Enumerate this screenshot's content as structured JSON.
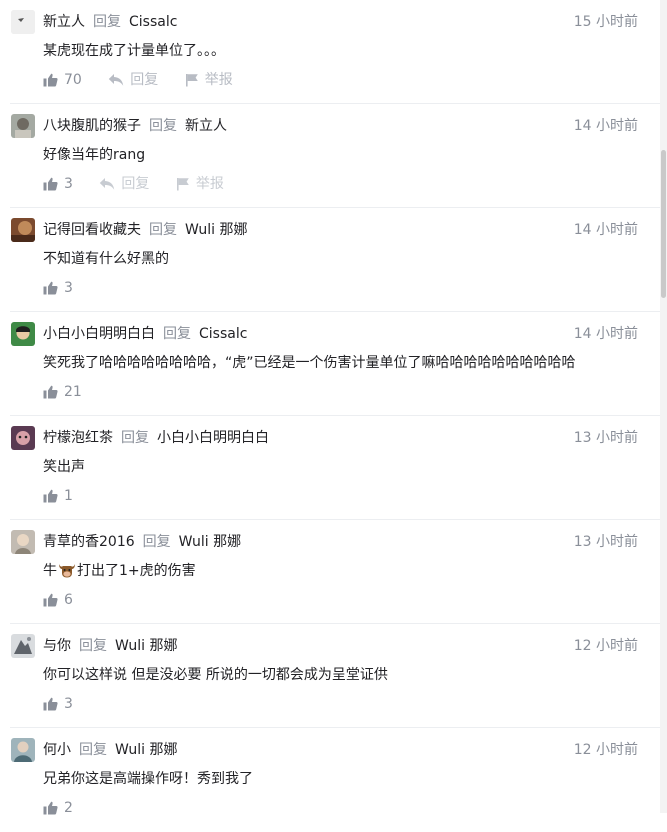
{
  "reply_word": "回复",
  "like_icon": "thumb-up-icon",
  "reply_icon": "reply-arrow-icon",
  "report_icon": "flag-icon",
  "comments": [
    {
      "user": "新立人",
      "reply_to": "Cissalc",
      "time": "15 小时前",
      "content": "某虎现在成了计量单位了。。。",
      "likes": "70",
      "reply_label": "回复",
      "report_label": "举报",
      "avatar_color": "#e8e8e8"
    },
    {
      "user": "八块腹肌的猴子",
      "reply_to": "新立人",
      "time": "14 小时前",
      "content": "好像当年的rang",
      "likes": "3",
      "reply_label": "回复",
      "report_label": "举报",
      "avatar_color": "#9aa19a"
    },
    {
      "user": "记得回看收藏夫",
      "reply_to": "Wuli 那娜",
      "time": "14 小时前",
      "content": "不知道有什么好黑的",
      "likes": "3",
      "avatar_color": "#8a5a3c"
    },
    {
      "user": "小白小白明明白白",
      "reply_to": "Cissalc",
      "time": "14 小时前",
      "content": "笑死我了哈哈哈哈哈哈哈哈，“虎”已经是一个伤害计量单位了嘛哈哈哈哈哈哈哈哈哈哈",
      "likes": "21",
      "avatar_color": "#2f7a3a"
    },
    {
      "user": "柠檬泡红茶",
      "reply_to": "小白小白明明白白",
      "time": "13 小时前",
      "content": "笑出声",
      "likes": "1",
      "avatar_color": "#6a3d5a"
    },
    {
      "user": "青草的香2016",
      "reply_to": "Wuli 那娜",
      "time": "13 小时前",
      "content_before": "牛",
      "content_after": "打出了1+虎的伤害",
      "emoji": "ox-emoji-icon",
      "likes": "6",
      "avatar_color": "#b7b0a8"
    },
    {
      "user": "与你",
      "reply_to": "Wuli 那娜",
      "time": "12 小时前",
      "content": "你可以这样说 但是没必要 所说的一切都会成为呈堂证供",
      "likes": "3",
      "avatar_color": "#7a7f86"
    },
    {
      "user": "何小",
      "reply_to": "Wuli 那娜",
      "time": "12 小时前",
      "content": "兄弟你这是高端操作呀！秀到我了",
      "likes": "2",
      "avatar_color": "#8aa0a8"
    }
  ]
}
